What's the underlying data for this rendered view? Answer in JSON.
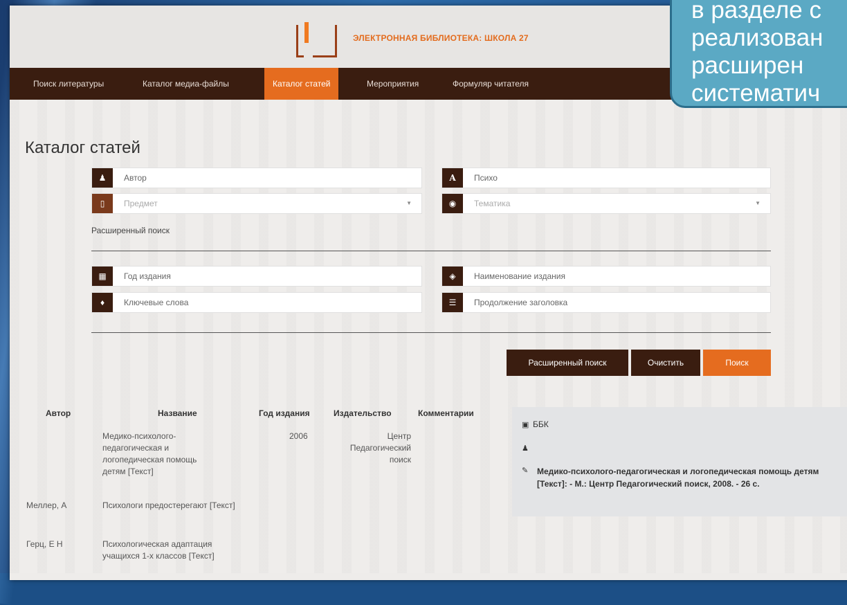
{
  "site": {
    "title": "ЭЛЕКТРОННАЯ БИБЛИОТЕКА: ШКОЛА 27"
  },
  "nav": {
    "items": [
      {
        "label": "Поиск литературы"
      },
      {
        "label": "Каталог медиа-файлы"
      },
      {
        "label": "Каталог статей"
      },
      {
        "label": "Мероприятия"
      },
      {
        "label": "Формуляр читателя"
      }
    ]
  },
  "page": {
    "title": "Каталог статей"
  },
  "search": {
    "author": "Автор",
    "title_field": "Психо",
    "subject_placeholder": "Предмет",
    "topic_placeholder": "Тематика",
    "advanced_label": "Расширенный поиск",
    "year": "Год издания",
    "publication_name": "Наименование издания",
    "keywords": "Ключевые слова",
    "title_continuation": "Продолжение заголовка"
  },
  "buttons": {
    "advanced": "Расширенный поиск",
    "clear": "Очистить",
    "search": "Поиск"
  },
  "table": {
    "headers": [
      "Автор",
      "Название",
      "Год издания",
      "Издательство",
      "Комментарии"
    ],
    "rows": [
      {
        "author": "",
        "title": "Медико-психолого-педагогическая и логопедическая помощь детям [Текст]",
        "year": "2006",
        "publisher": "Центр Педагогический поиск"
      },
      {
        "author": "Меллер, А",
        "title": "Психологи предостерегают [Текст]",
        "year": "",
        "publisher": ""
      },
      {
        "author": "Герц, Е Н",
        "title": "Психологическая адаптация учащихся 1-х классов [Текст]",
        "year": "",
        "publisher": ""
      }
    ]
  },
  "detail": {
    "bbk_label": "ББК",
    "author": "",
    "description": "Медико-психолого-педагогическая и логопедическая помощь детям [Текст]: - М.: Центр Педагогический поиск, 2008. - 26 с."
  },
  "callout": {
    "lines": [
      "в разделе с",
      "реализован",
      "расширен",
      "систематич"
    ]
  },
  "colors": {
    "accent": "#e56c1f",
    "nav_bg": "#3a1d10",
    "callout_bg": "#5ba9c4"
  },
  "icons": [
    "user-icon",
    "letter-a-icon",
    "bookmark-icon",
    "topic-icon",
    "calendar-icon",
    "edition-icon",
    "tag-icon",
    "title-icon",
    "book-icon"
  ]
}
